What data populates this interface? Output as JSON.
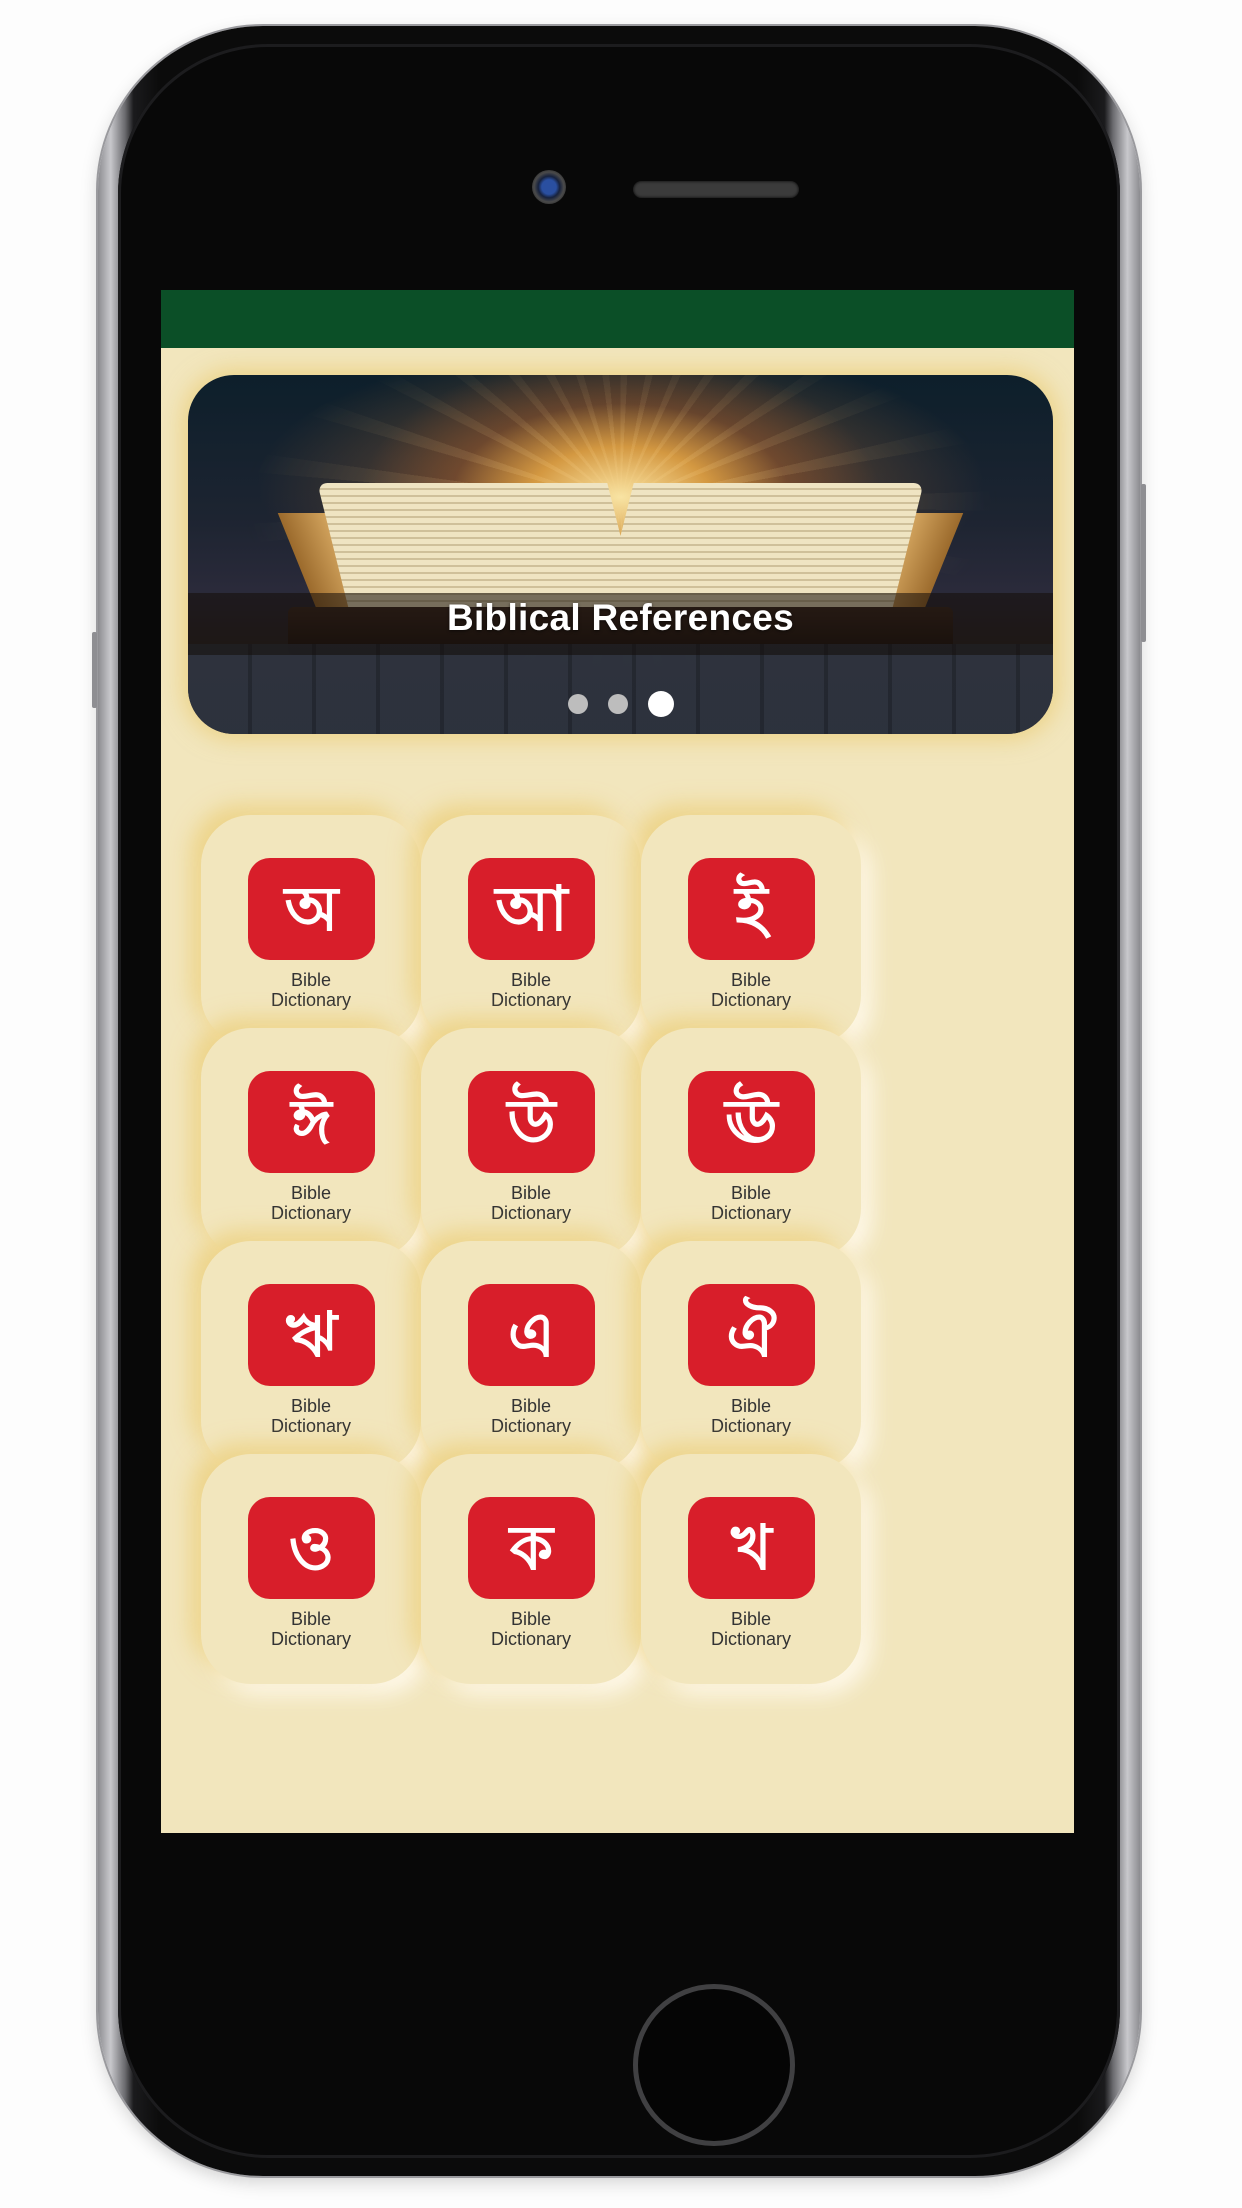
{
  "device": {
    "type": "phone"
  },
  "app": {
    "appbar_color": "#0b4f27",
    "background_color": "#f2e6bd",
    "accent_tile_color": "#d81e2a"
  },
  "banner": {
    "caption": "Biblical References",
    "image": "glowing-open-bible-image",
    "slides": 3,
    "active_slide": 3
  },
  "grid": {
    "items": [
      {
        "letter": "অ",
        "line1": "Bible",
        "line2": "Dictionary"
      },
      {
        "letter": "আ",
        "line1": "Bible",
        "line2": "Dictionary"
      },
      {
        "letter": "ই",
        "line1": "Bible",
        "line2": "Dictionary"
      },
      {
        "letter": "ঈ",
        "line1": "Bible",
        "line2": "Dictionary"
      },
      {
        "letter": "উ",
        "line1": "Bible",
        "line2": "Dictionary"
      },
      {
        "letter": "ঊ",
        "line1": "Bible",
        "line2": "Dictionary"
      },
      {
        "letter": "ঋ",
        "line1": "Bible",
        "line2": "Dictionary"
      },
      {
        "letter": "এ",
        "line1": "Bible",
        "line2": "Dictionary"
      },
      {
        "letter": "ঐ",
        "line1": "Bible",
        "line2": "Dictionary"
      },
      {
        "letter": "ও",
        "line1": "Bible",
        "line2": "Dictionary"
      },
      {
        "letter": "ক",
        "line1": "Bible",
        "line2": "Dictionary"
      },
      {
        "letter": "খ",
        "line1": "Bible",
        "line2": "Dictionary"
      }
    ]
  }
}
